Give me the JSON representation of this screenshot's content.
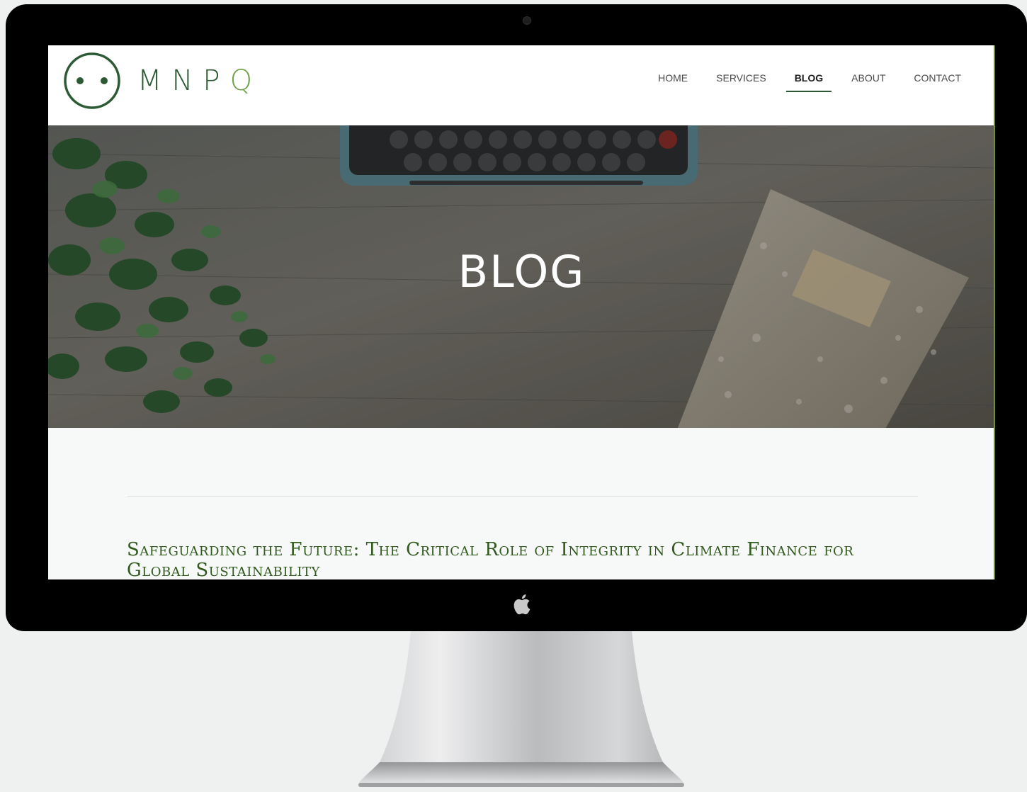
{
  "logo": {
    "text": "MNP",
    "text_last": "Q",
    "icon": "face-circle-logo-icon"
  },
  "nav": {
    "items": [
      {
        "label": "HOME",
        "active": false
      },
      {
        "label": "SERVICES",
        "active": false
      },
      {
        "label": "BLOG",
        "active": true
      },
      {
        "label": "ABOUT",
        "active": false
      },
      {
        "label": "CONTACT",
        "active": false
      }
    ]
  },
  "hero": {
    "title": "BLOG",
    "image": "desk-with-typewriter-plant-notebook"
  },
  "post": {
    "title": "Safeguarding the Future: The Critical Role of Integrity in Climate Finance for Global Sustainability"
  },
  "device": {
    "icon": "apple-logo-icon"
  },
  "colors": {
    "brand_dark": "#2c5a35",
    "brand_light": "#6ea34a",
    "post_title": "#2f5a1c",
    "bezel": "#000000"
  }
}
